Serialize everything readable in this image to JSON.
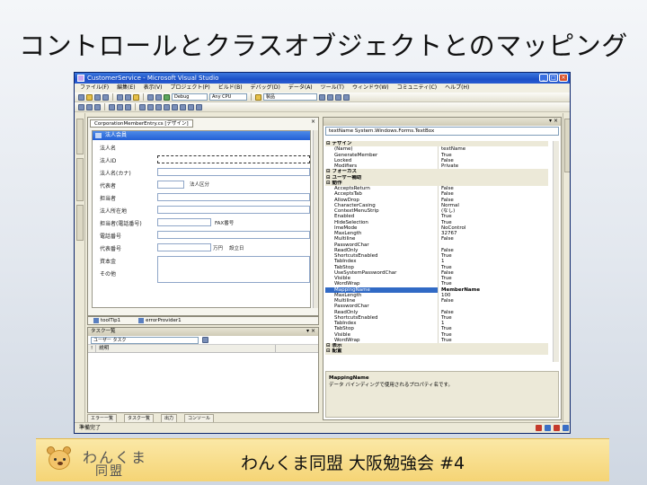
{
  "slide": {
    "title": "コントロールとクラスオブジェクトとのマッピング"
  },
  "window": {
    "title": "CustomerService - Microsoft Visual Studio",
    "menu": [
      "ファイル(F)",
      "編集(E)",
      "表示(V)",
      "プロジェクト(P)",
      "ビルド(B)",
      "デバッグ(D)",
      "データ(A)",
      "ツール(T)",
      "ウィンドウ(W)",
      "コミュニティ(C)",
      "ヘルプ(H)"
    ],
    "toolbar": {
      "config": "Debug",
      "platform": "Any CPU",
      "find": "製品"
    }
  },
  "designer": {
    "tab": "CorporationMemberEntry.cs [デザイン]",
    "form_title": "法人会員",
    "labels": [
      "法人名",
      "法人ID",
      "法人名(カナ)",
      "代表者",
      "担当者",
      "法人所在地",
      "担当者(電話番号)",
      "電話番号",
      "代表番号",
      "資本金",
      "その他"
    ],
    "inline_labels": {
      "inline_1": "法人区分",
      "inline_2": "FAX番号",
      "inline_3": "万円",
      "inline_4": "設立日"
    },
    "tray_items": [
      "toolTip1",
      "errorProvider1"
    ]
  },
  "tasklist": {
    "title": "タスク一覧",
    "filter": "ユーザー タスク",
    "columns": [
      "!",
      "説明"
    ]
  },
  "bottom_tabs": [
    "エラー一覧",
    "タスク一覧",
    "出力",
    "コンソール"
  ],
  "properties": {
    "object": "textName System.Windows.Forms.TextBox",
    "rows": [
      {
        "type": "cat",
        "name": "デザイン",
        "value": ""
      },
      {
        "type": "prop",
        "name": "(Name)",
        "value": "textName"
      },
      {
        "type": "prop",
        "name": "GenerateMember",
        "value": "True"
      },
      {
        "type": "prop",
        "name": "Locked",
        "value": "False"
      },
      {
        "type": "prop",
        "name": "Modifiers",
        "value": "Private"
      },
      {
        "type": "cat",
        "name": "フォーカス",
        "value": ""
      },
      {
        "type": "cat",
        "name": "ユーザー補助",
        "value": ""
      },
      {
        "type": "cat",
        "name": "動作",
        "value": ""
      },
      {
        "type": "prop",
        "name": "AcceptsReturn",
        "value": "False"
      },
      {
        "type": "prop",
        "name": "AcceptsTab",
        "value": "False"
      },
      {
        "type": "prop",
        "name": "AllowDrop",
        "value": "False"
      },
      {
        "type": "prop",
        "name": "CharacterCasing",
        "value": "Normal"
      },
      {
        "type": "prop",
        "name": "ContextMenuStrip",
        "value": "(なし)"
      },
      {
        "type": "prop",
        "name": "Enabled",
        "value": "True"
      },
      {
        "type": "prop",
        "name": "HideSelection",
        "value": "True"
      },
      {
        "type": "prop",
        "name": "ImeMode",
        "value": "NoControl"
      },
      {
        "type": "prop",
        "name": "MaxLength",
        "value": "32767"
      },
      {
        "type": "prop",
        "name": "Multiline",
        "value": "False"
      },
      {
        "type": "prop",
        "name": "PasswordChar",
        "value": ""
      },
      {
        "type": "prop",
        "name": "ReadOnly",
        "value": "False"
      },
      {
        "type": "prop",
        "name": "ShortcutsEnabled",
        "value": "True"
      },
      {
        "type": "prop",
        "name": "TabIndex",
        "value": "1"
      },
      {
        "type": "prop",
        "name": "TabStop",
        "value": "True"
      },
      {
        "type": "prop",
        "name": "UseSystemPasswordChar",
        "value": "False"
      },
      {
        "type": "prop",
        "name": "Visible",
        "value": "True"
      },
      {
        "type": "prop",
        "name": "WordWrap",
        "value": "True"
      },
      {
        "type": "prop",
        "name": "MappingName",
        "value": "MemberName",
        "selected": true
      },
      {
        "type": "prop",
        "name": "MaxLength",
        "value": "100"
      },
      {
        "type": "prop",
        "name": "Multiline",
        "value": "False"
      },
      {
        "type": "prop",
        "name": "PasswordChar",
        "value": ""
      },
      {
        "type": "prop",
        "name": "ReadOnly",
        "value": "False"
      },
      {
        "type": "prop",
        "name": "ShortcutsEnabled",
        "value": "True"
      },
      {
        "type": "prop",
        "name": "TabIndex",
        "value": "1"
      },
      {
        "type": "prop",
        "name": "TabStop",
        "value": "True"
      },
      {
        "type": "prop",
        "name": "Visible",
        "value": "True"
      },
      {
        "type": "prop",
        "name": "WordWrap",
        "value": "True"
      },
      {
        "type": "cat",
        "name": "表示",
        "value": ""
      },
      {
        "type": "cat",
        "name": "配置",
        "value": ""
      }
    ],
    "desc_title": "MappingName",
    "desc_text": "データ バインディングで使用されるプロパティ名です。"
  },
  "status": "準備完了",
  "footer": {
    "logo_word": "わんくま",
    "logo_sub": "同盟",
    "event": "わんくま同盟 大阪勉強会 #4"
  }
}
